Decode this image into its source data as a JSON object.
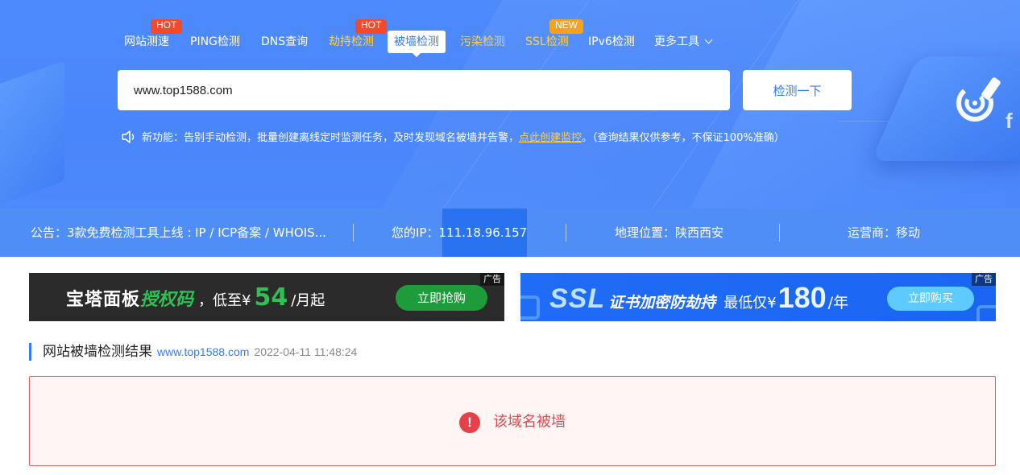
{
  "nav": {
    "items": [
      {
        "label": "网站测速",
        "badge": "HOT"
      },
      {
        "label": "PING检测"
      },
      {
        "label": "DNS查询"
      },
      {
        "label": "劫持检测",
        "badge": "HOT"
      },
      {
        "label": "被墙检测"
      },
      {
        "label": "污染检测"
      },
      {
        "label": "SSL检测",
        "badge": "NEW"
      },
      {
        "label": "IPv6检测"
      },
      {
        "label": "更多工具"
      }
    ],
    "active": "被墙检测"
  },
  "search": {
    "value": "www.top1588.com",
    "button_label": "检测一下"
  },
  "notice": {
    "prefix": "新功能：告别手动检测，批量创建离线定时监测任务，及时发现域名被墙并告警，",
    "link": "点此创建监控",
    "suffix": "。（查询结果仅供参考，不保证100%准确）"
  },
  "infobar": {
    "announcement": "公告：3款免费检测工具上线 : IP / ICP备案 / WHOIS...",
    "ip_label": "您的IP：",
    "ip_value": "111.18.96.157",
    "location": "地理位置：陕西西安",
    "isp": "运营商：移动"
  },
  "ads": {
    "left": {
      "tag": "广告",
      "brand": "宝塔面板",
      "product": "授权码",
      "price_prefix": "，低至¥",
      "price": "54",
      "price_unit": "/月起",
      "button": "立即抢购"
    },
    "right": {
      "tag": "广告",
      "ssl": "SSL",
      "product": "证书加密防劫持",
      "price_prefix": "最低仅¥",
      "price": "180",
      "price_unit": "/年",
      "button": "立即购买"
    }
  },
  "result": {
    "title": "网站被墙检测结果",
    "domain": "www.top1588.com",
    "time": "2022-04-11 11:48:24",
    "message": "该域名被墙",
    "error_glyph": "!"
  },
  "colors": {
    "primary": "#2f7cf6",
    "hero_bg": "#4a86fb",
    "hot": "#f24b2c",
    "new": "#f6a21f",
    "highlight": "#ffd24a",
    "error": "#e4414a",
    "error_bg": "#fff5f5"
  }
}
